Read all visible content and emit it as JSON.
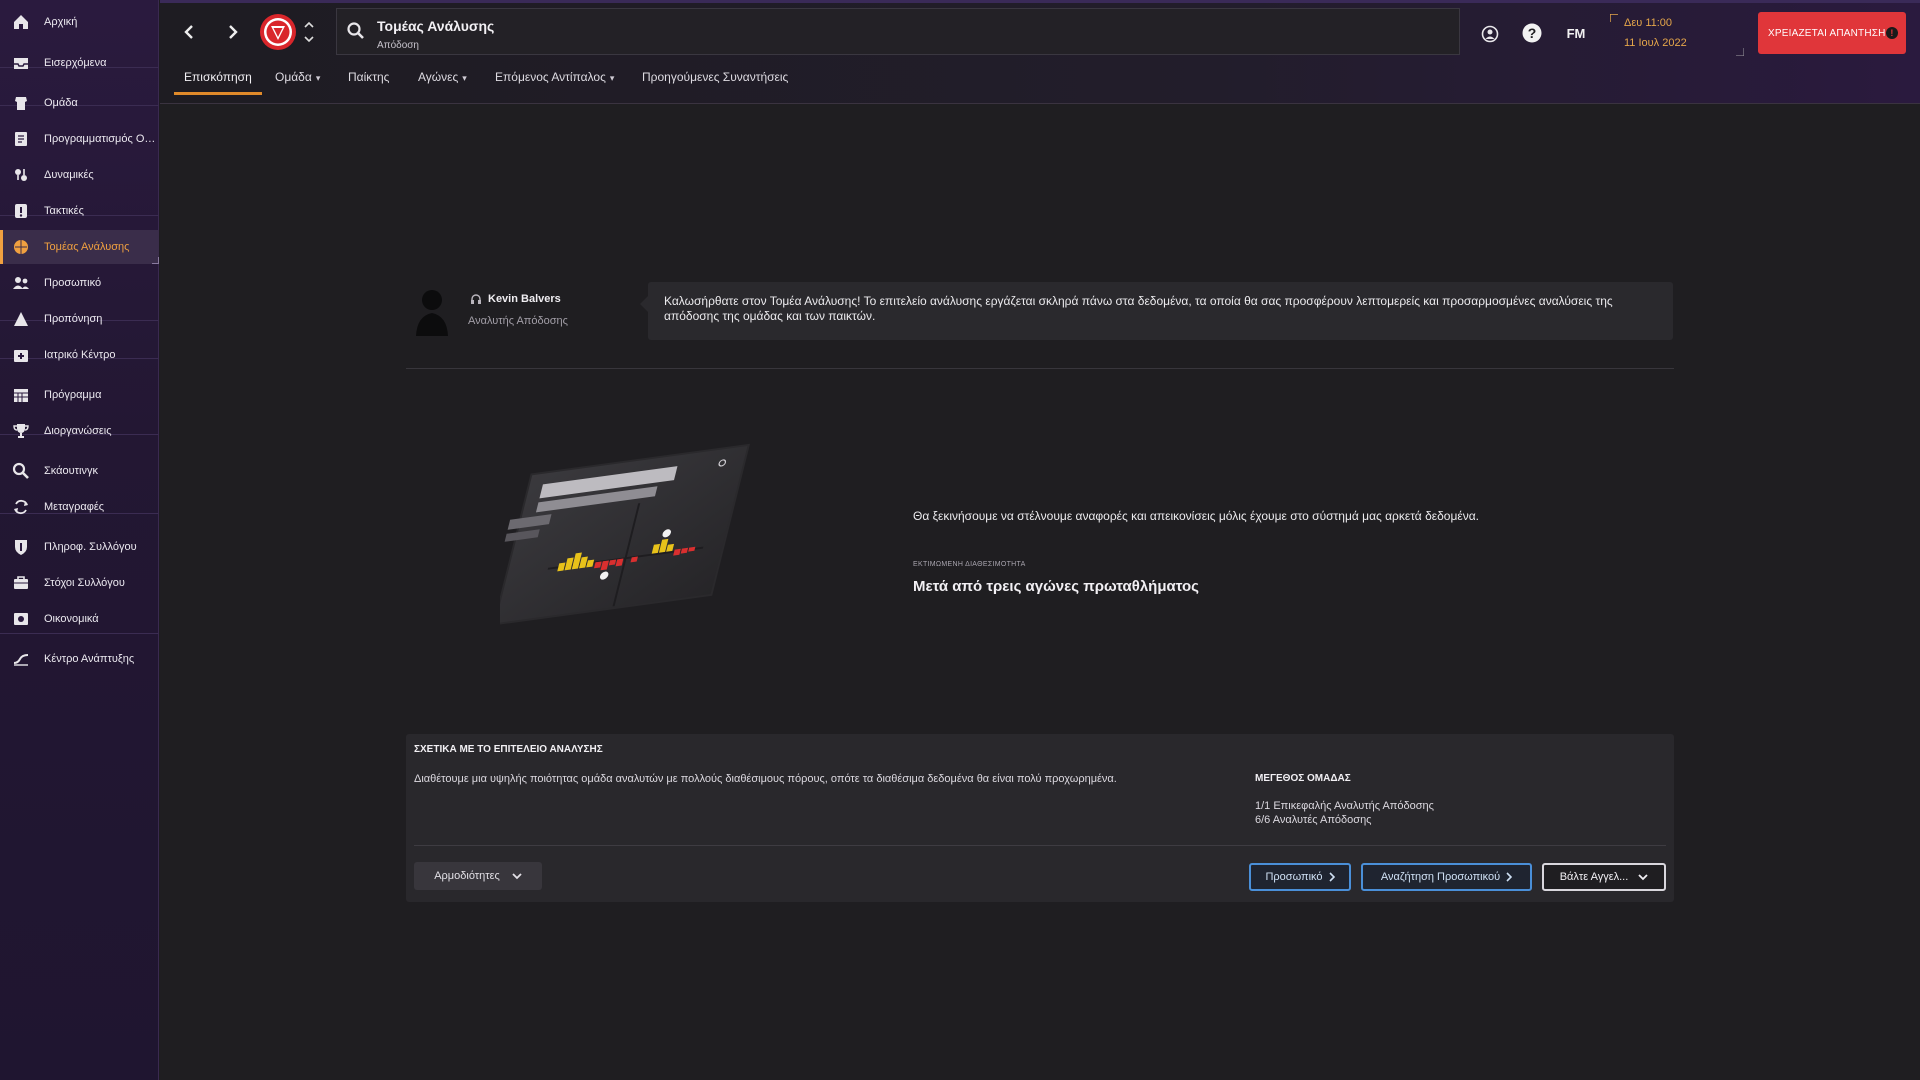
{
  "sidebar": {
    "items": [
      {
        "label": "Αρχική",
        "icon": "home-icon"
      },
      {
        "label": "Εισερχόμενα",
        "icon": "inbox-icon"
      },
      {
        "label": "Ομάδα",
        "icon": "squad-icon"
      },
      {
        "label": "Προγραμματισμός Ομ...",
        "icon": "planner-icon"
      },
      {
        "label": "Δυναμικές",
        "icon": "dynamics-icon"
      },
      {
        "label": "Τακτικές",
        "icon": "tactics-icon"
      },
      {
        "label": "Τομέας Ανάλυσης",
        "icon": "analysis-icon",
        "active": true
      },
      {
        "label": "Προσωπικό",
        "icon": "staff-icon"
      },
      {
        "label": "Προπόνηση",
        "icon": "training-icon"
      },
      {
        "label": "Ιατρικό Κέντρο",
        "icon": "medical-icon"
      },
      {
        "label": "Πρόγραμμα",
        "icon": "schedule-icon"
      },
      {
        "label": "Διοργανώσεις",
        "icon": "trophy-icon"
      },
      {
        "label": "Σκάουτινγκ",
        "icon": "scouting-icon"
      },
      {
        "label": "Μεταγραφές",
        "icon": "transfers-icon"
      },
      {
        "label": "Πληροφ. Συλλόγου",
        "icon": "club-info-icon"
      },
      {
        "label": "Στόχοι Συλλόγου",
        "icon": "club-goals-icon"
      },
      {
        "label": "Οικονομικά",
        "icon": "finances-icon"
      },
      {
        "label": "Κέντρο Ανάπτυξης",
        "icon": "development-icon"
      }
    ]
  },
  "header": {
    "search_title": "Τομέας Ανάλυσης",
    "search_subtitle": "Απόδοση",
    "fm_label": "FM",
    "date_line1": "Δευ 11:00",
    "date_line2": "11 Ιουλ 2022",
    "reply_label": "ΧΡΕΙΑΖΕΤΑΙ ΑΠΑΝΤΗΣΗ",
    "reply_color": "#e0363a",
    "accent_color": "#e08a2a"
  },
  "tabs": [
    {
      "label": "Επισκόπηση",
      "active": true,
      "dropdown": false
    },
    {
      "label": "Ομάδα",
      "dropdown": true
    },
    {
      "label": "Παίκτης",
      "dropdown": false
    },
    {
      "label": "Αγώνες",
      "dropdown": true
    },
    {
      "label": "Επόμενος Αντίπαλος",
      "dropdown": true
    },
    {
      "label": "Προηγούμενες Συναντήσεις",
      "dropdown": false
    }
  ],
  "analyst": {
    "name": "Kevin Balvers",
    "role": "Αναλυτής Απόδοσης",
    "welcome": "Καλωσήρθατε στον Τομέα Ανάλυσης! Το επιτελείο ανάλυσης εργάζεται σκληρά πάνω στα δεδομένα, τα οποία θα σας προσφέρουν λεπτομερείς και προσαρμοσμένες αναλύσεις της απόδοσης της ομάδας και των παικτών."
  },
  "pending": {
    "message": "Θα ξεκινήσουμε να στέλνουμε αναφορές και απεικονίσεις μόλις έχουμε στο σύστημά μας αρκετά δεδομένα.",
    "eta_label": "ΕΚΤΙΜΩΜΕΝΗ ΔΙΑΘΕΣΙΜΟΤΗΤΑ",
    "eta_value": "Μετά από τρεις αγώνες πρωταθλήματος"
  },
  "about": {
    "title": "ΣΧΕΤΙΚΑ ΜΕ ΤΟ ΕΠΙΤΕΛΕΙΟ ΑΝΑΛΥΣΗΣ",
    "description": "Διαθέτουμε μια υψηλής ποιότητας ομάδα αναλυτών με πολλούς διαθέσιμους πόρους, οπότε τα διαθέσιμα δεδομένα θα είναι πολύ προχωρημένα.",
    "size_title": "ΜΕΓΕΘΟΣ ΟΜΑΔΑΣ",
    "size_line1": "1/1 Επικεφαλής Αναλυτής Απόδοσης",
    "size_line2": "6/6 Αναλυτές Απόδοσης",
    "roles_button": "Αρμοδιότητες",
    "staff_button": "Προσωπικό",
    "search_staff_button": "Αναζήτηση Προσωπικού",
    "ad_button": "Βάλτε Αγγελ..."
  }
}
